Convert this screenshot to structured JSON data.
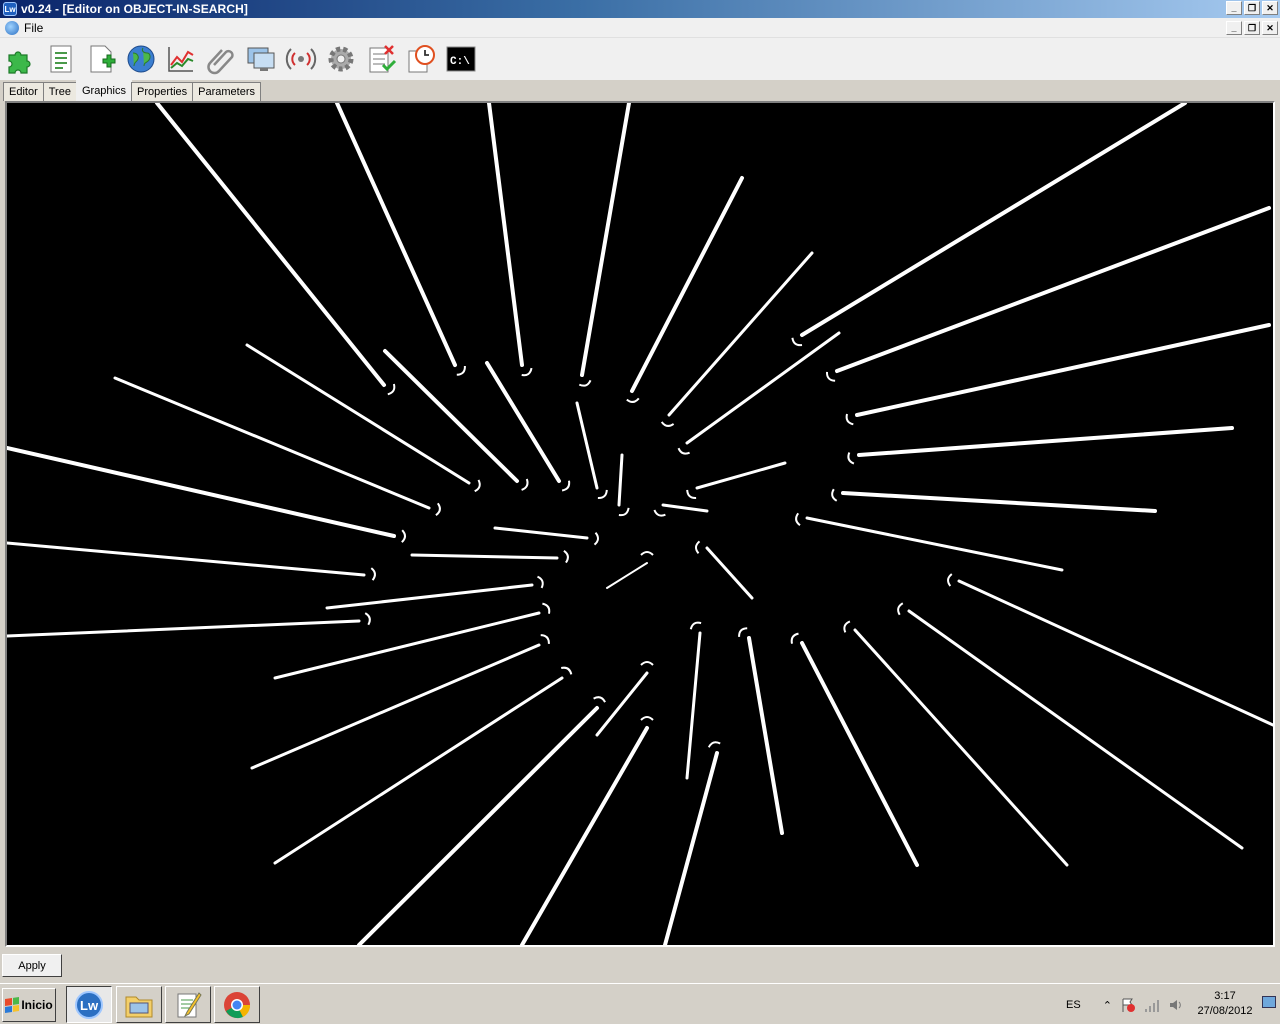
{
  "window": {
    "title": "v0.24 - [Editor on OBJECT-IN-SEARCH]",
    "app_icon_text": "Lw"
  },
  "menu": {
    "items": [
      "File"
    ]
  },
  "toolbar": {
    "icons": [
      "puzzle-icon",
      "document-icon",
      "add-document-icon",
      "globe-icon",
      "chart-icon",
      "paperclip-icon",
      "monitor-icon",
      "broadcast-icon",
      "gear-icon",
      "delete-list-icon",
      "clock-icon",
      "console-icon"
    ],
    "console_label": "C:\\"
  },
  "tabs": [
    {
      "label": "Editor",
      "active": false
    },
    {
      "label": "Tree",
      "active": false
    },
    {
      "label": "Graphics",
      "active": true
    },
    {
      "label": "Properties",
      "active": false
    },
    {
      "label": "Parameters",
      "active": false
    }
  ],
  "apply_label": "Apply",
  "taskbar": {
    "start_label": "Inicio",
    "apps": [
      "lw-app-icon",
      "file-explorer-icon",
      "notepad-icon",
      "chrome-icon"
    ],
    "language": "ES",
    "time": "3:17",
    "date": "27/08/2012"
  },
  "colors": {
    "canvas_background": "#000000",
    "lines": "#ffffff",
    "titlebar_start": "#0a246a",
    "titlebar_end": "#a6caf0"
  }
}
